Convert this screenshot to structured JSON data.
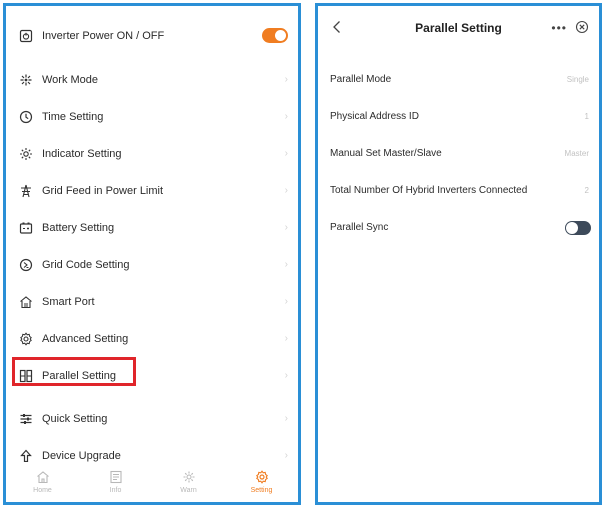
{
  "left_panel": {
    "power": {
      "label": "Inverter Power ON / OFF",
      "toggle_state": "on"
    },
    "menu": [
      {
        "label": "Work Mode",
        "icon": "work-mode-icon"
      },
      {
        "label": "Time Setting",
        "icon": "clock-icon"
      },
      {
        "label": "Indicator Setting",
        "icon": "indicator-icon"
      },
      {
        "label": "Grid Feed in Power Limit",
        "icon": "grid-tower-icon"
      },
      {
        "label": "Battery Setting",
        "icon": "battery-icon"
      },
      {
        "label": "Grid Code Setting",
        "icon": "grid-code-icon"
      },
      {
        "label": "Smart Port",
        "icon": "smart-port-icon"
      },
      {
        "label": "Advanced Setting",
        "icon": "gear-icon"
      },
      {
        "label": "Parallel Setting",
        "icon": "parallel-icon",
        "highlighted": true
      },
      {
        "label": "Quick Setting",
        "icon": "sliders-icon"
      },
      {
        "label": "Device Upgrade",
        "icon": "upgrade-icon"
      }
    ],
    "nav": [
      {
        "label": "Home",
        "icon": "home-icon"
      },
      {
        "label": "Info",
        "icon": "info-list-icon"
      },
      {
        "label": "Warn",
        "icon": "warning-icon"
      },
      {
        "label": "Setting",
        "icon": "setting-gear-icon",
        "active": true
      }
    ],
    "accent": "#f07d21",
    "highlight_color": "#e0252a"
  },
  "right_panel": {
    "title": "Parallel Setting",
    "more_label": "•••",
    "rows": [
      {
        "label": "Parallel Mode",
        "value": "Single"
      },
      {
        "label": "Physical Address ID",
        "value": "1"
      },
      {
        "label": "Manual Set Master/Slave",
        "value": "Master"
      },
      {
        "label": "Total Number Of Hybrid Inverters Connected",
        "value": "2"
      }
    ],
    "sync": {
      "label": "Parallel Sync",
      "toggle_state": "off"
    }
  },
  "frame_color": "#2a8fd6"
}
